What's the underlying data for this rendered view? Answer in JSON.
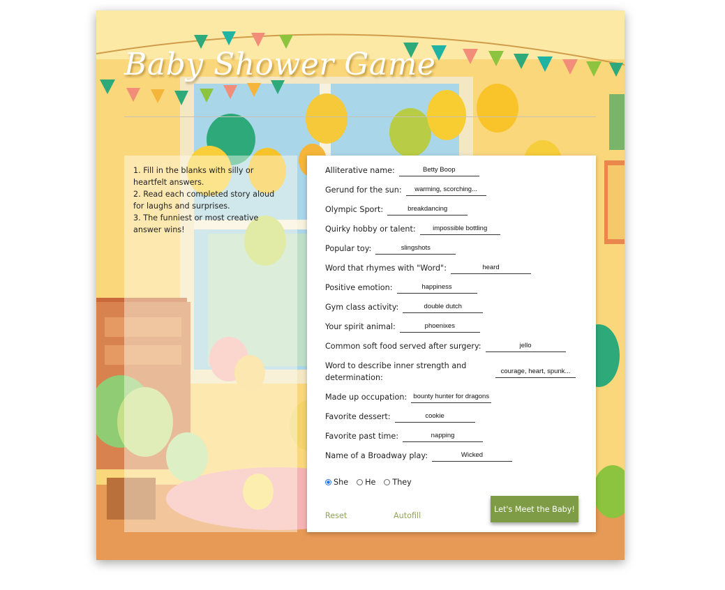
{
  "title": "Baby Shower Game",
  "instructions": [
    "1. Fill in the blanks with silly or heartfelt answers.",
    "2. Read each completed story aloud for laughs and surprises.",
    "3. The funniest or most creative answer wins!"
  ],
  "fields": [
    {
      "label": "Alliterative name:",
      "value": "Betty Boop"
    },
    {
      "label": "Gerund for the sun:",
      "value": "warming, scorching..."
    },
    {
      "label": "Olympic Sport:",
      "value": "breakdancing"
    },
    {
      "label": "Quirky hobby or talent:",
      "value": "impossible bottling"
    },
    {
      "label": "Popular toy:",
      "value": "slingshots"
    },
    {
      "label": "Word that rhymes with \"Word\":",
      "value": "heard"
    },
    {
      "label": "Positive emotion:",
      "value": "happiness"
    },
    {
      "label": "Gym class activity:",
      "value": "double dutch"
    },
    {
      "label": "Your spirit animal:",
      "value": "phoenixes"
    },
    {
      "label": "Common soft food served after surgery:",
      "value": "jello"
    },
    {
      "label": "Word to describe inner strength and determination:",
      "value": "courage, heart, spunk..."
    },
    {
      "label": "Made up occupation:",
      "value": "bounty hunter for dragons"
    },
    {
      "label": "Favorite dessert:",
      "value": "cookie"
    },
    {
      "label": "Favorite past time:",
      "value": "napping"
    },
    {
      "label": "Name of a Broadway play:",
      "value": "Wicked"
    }
  ],
  "pronouns": {
    "options": [
      "She",
      "He",
      "They"
    ],
    "selected": "She"
  },
  "buttons": {
    "reset": "Reset",
    "autofill": "Autofill",
    "submit": "Let's Meet the Baby!"
  },
  "colors": {
    "accent": "#7e9c45",
    "link": "#8fa556",
    "radio_selected": "#1a73e8"
  }
}
